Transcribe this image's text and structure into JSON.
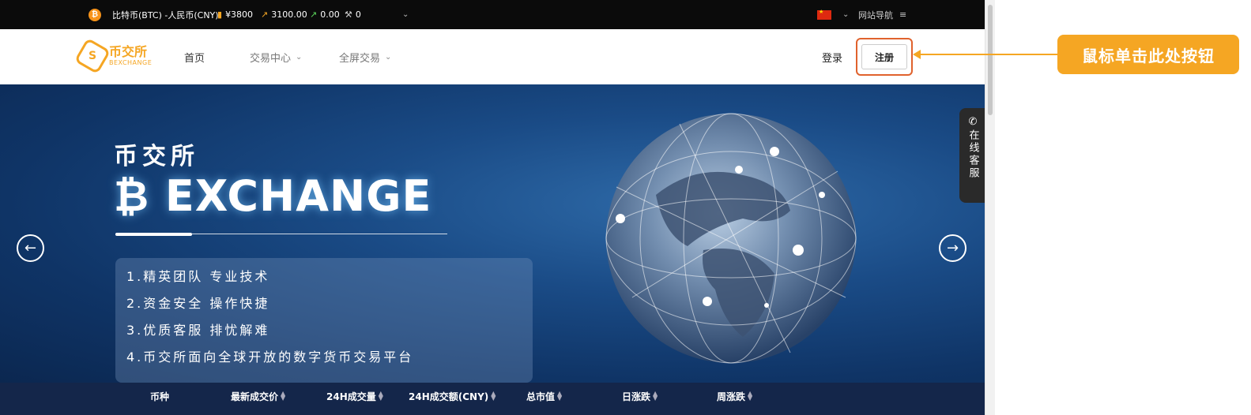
{
  "topbar": {
    "coin_icon": "bitcoin-icon",
    "pair": "比特币(BTC) -人民币(CNY)",
    "price": "¥3800",
    "change_value": "3100.00",
    "volume": "0.00",
    "count": "0",
    "site_nav": "网站导航"
  },
  "nav": {
    "logo_cn": "币交所",
    "logo_en": "BEXCHANGE",
    "home": "首页",
    "trade_center": "交易中心",
    "fullscreen_trade": "全屏交易",
    "login": "登录",
    "register": "注册"
  },
  "hero": {
    "title_cn": "币交所",
    "title_en": "EXCHANGE",
    "features": [
      "1.精英团队 专业技术",
      "2.资金安全 操作快捷",
      "3.优质客服 排忧解难",
      "4.币交所面向全球开放的数字货币交易平台"
    ],
    "service_text": "在线客服"
  },
  "table_header": [
    "币种",
    "最新成交价",
    "24H成交量",
    "24H成交额(CNY)",
    "总市值",
    "日涨跌",
    "周涨跌"
  ],
  "annotation": {
    "text": "鼠标单击此处按钮",
    "color": "#f5a623"
  },
  "colors": {
    "brand": "#f5a623",
    "highlight": "#e0622d",
    "topbar": "#0b0b0b",
    "table_header": "#14264a"
  }
}
